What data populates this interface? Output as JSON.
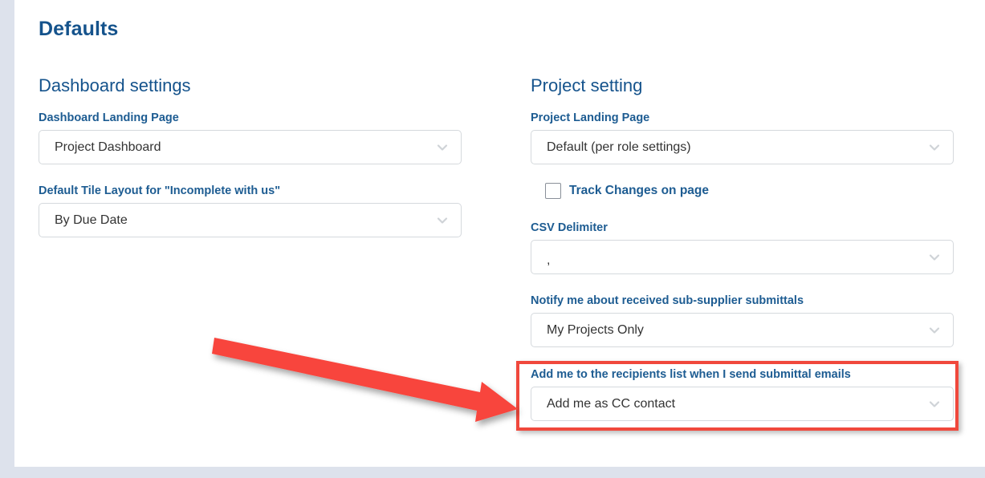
{
  "page": {
    "title": "Defaults",
    "background_color": "#dde2ec",
    "card_color": "#ffffff",
    "accent_color": "#15538c",
    "highlight_color": "#f0483c"
  },
  "dashboard_section": {
    "title": "Dashboard settings",
    "fields": [
      {
        "label": "Dashboard Landing Page",
        "value": "Project Dashboard",
        "icon": "chevron-down-icon"
      },
      {
        "label": "Default Tile Layout for \"Incomplete with us\"",
        "value": "By Due Date",
        "icon": "chevron-down-icon"
      }
    ]
  },
  "project_section": {
    "title": "Project setting",
    "landing_page": {
      "label": "Project Landing Page",
      "value": "Default (per role settings)",
      "icon": "chevron-down-icon"
    },
    "track_changes": {
      "label": "Track Changes on page",
      "checked": false
    },
    "csv_delimiter": {
      "label": "CSV Delimiter",
      "value": ",",
      "icon": "chevron-down-icon"
    },
    "notify_sub_supplier": {
      "label": "Notify me about received sub-supplier submittals",
      "value": "My Projects Only",
      "icon": "chevron-down-icon"
    },
    "recipients_list": {
      "label": "Add me to the recipients list when I send submittal emails",
      "value": "Add me as CC contact",
      "icon": "chevron-down-icon"
    }
  },
  "annotation": {
    "arrow": "red-arrow-pointing-right",
    "color": "#f0483c"
  }
}
